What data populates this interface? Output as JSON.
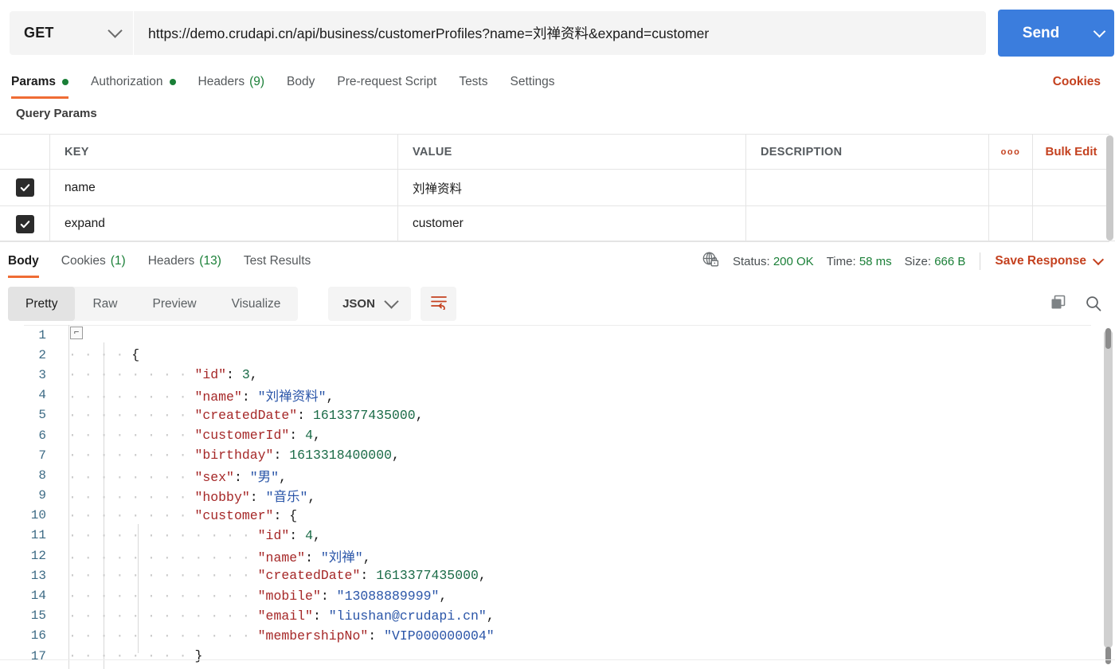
{
  "request": {
    "method": "GET",
    "url": "https://demo.crudapi.cn/api/business/customerProfiles?name=刘禅资料&expand=customer",
    "send_label": "Send",
    "tabs": [
      {
        "label": "Params",
        "badge_dot": true,
        "active": true
      },
      {
        "label": "Authorization",
        "badge_dot": true,
        "active": false
      },
      {
        "label": "Headers",
        "count": "(9)",
        "active": false
      },
      {
        "label": "Body",
        "active": false
      },
      {
        "label": "Pre-request Script",
        "active": false
      },
      {
        "label": "Tests",
        "active": false
      },
      {
        "label": "Settings",
        "active": false
      }
    ],
    "cookies_link": "Cookies"
  },
  "query_params": {
    "title": "Query Params",
    "columns": [
      "KEY",
      "VALUE",
      "DESCRIPTION"
    ],
    "dots_label": "ooo",
    "bulk_edit_label": "Bulk Edit",
    "rows": [
      {
        "checked": true,
        "key": "name",
        "value": "刘禅资料",
        "description": ""
      },
      {
        "checked": true,
        "key": "expand",
        "value": "customer",
        "description": ""
      }
    ]
  },
  "response": {
    "tabs": [
      {
        "label": "Body",
        "active": true
      },
      {
        "label": "Cookies",
        "count": "(1)",
        "active": false
      },
      {
        "label": "Headers",
        "count": "(13)",
        "active": false
      },
      {
        "label": "Test Results",
        "active": false
      }
    ],
    "status_label": "Status:",
    "status_value": "200 OK",
    "time_label": "Time:",
    "time_value": "58 ms",
    "size_label": "Size:",
    "size_value": "666 B",
    "save_response_label": "Save Response",
    "view_modes": [
      {
        "label": "Pretty",
        "active": true
      },
      {
        "label": "Raw",
        "active": false
      },
      {
        "label": "Preview",
        "active": false
      },
      {
        "label": "Visualize",
        "active": false
      }
    ],
    "format": "JSON"
  },
  "colors": {
    "accent_orange": "#ef6c34",
    "link_red": "#c4411f",
    "send_blue": "#3b7ddd",
    "success_green": "#1a7f37",
    "json_key": "#a52727",
    "json_string": "#2a55a8",
    "json_number": "#1a6b47"
  },
  "code": {
    "lines": [
      {
        "num": "1",
        "indent": 0,
        "fold": true,
        "tokens": []
      },
      {
        "num": "2",
        "indent": 1,
        "tokens": [
          {
            "t": "p",
            "v": "{"
          }
        ]
      },
      {
        "num": "3",
        "indent": 2,
        "tokens": [
          {
            "t": "k",
            "v": "\"id\""
          },
          {
            "t": "p",
            "v": ": "
          },
          {
            "t": "n",
            "v": "3"
          },
          {
            "t": "p",
            "v": ","
          }
        ]
      },
      {
        "num": "4",
        "indent": 2,
        "tokens": [
          {
            "t": "k",
            "v": "\"name\""
          },
          {
            "t": "p",
            "v": ": "
          },
          {
            "t": "s",
            "v": "\"刘禅资料\""
          },
          {
            "t": "p",
            "v": ","
          }
        ]
      },
      {
        "num": "5",
        "indent": 2,
        "tokens": [
          {
            "t": "k",
            "v": "\"createdDate\""
          },
          {
            "t": "p",
            "v": ": "
          },
          {
            "t": "n",
            "v": "1613377435000"
          },
          {
            "t": "p",
            "v": ","
          }
        ]
      },
      {
        "num": "6",
        "indent": 2,
        "tokens": [
          {
            "t": "k",
            "v": "\"customerId\""
          },
          {
            "t": "p",
            "v": ": "
          },
          {
            "t": "n",
            "v": "4"
          },
          {
            "t": "p",
            "v": ","
          }
        ]
      },
      {
        "num": "7",
        "indent": 2,
        "tokens": [
          {
            "t": "k",
            "v": "\"birthday\""
          },
          {
            "t": "p",
            "v": ": "
          },
          {
            "t": "n",
            "v": "1613318400000"
          },
          {
            "t": "p",
            "v": ","
          }
        ]
      },
      {
        "num": "8",
        "indent": 2,
        "tokens": [
          {
            "t": "k",
            "v": "\"sex\""
          },
          {
            "t": "p",
            "v": ": "
          },
          {
            "t": "s",
            "v": "\"男\""
          },
          {
            "t": "p",
            "v": ","
          }
        ]
      },
      {
        "num": "9",
        "indent": 2,
        "tokens": [
          {
            "t": "k",
            "v": "\"hobby\""
          },
          {
            "t": "p",
            "v": ": "
          },
          {
            "t": "s",
            "v": "\"音乐\""
          },
          {
            "t": "p",
            "v": ","
          }
        ]
      },
      {
        "num": "10",
        "indent": 2,
        "tokens": [
          {
            "t": "k",
            "v": "\"customer\""
          },
          {
            "t": "p",
            "v": ": {"
          }
        ]
      },
      {
        "num": "11",
        "indent": 3,
        "tokens": [
          {
            "t": "k",
            "v": "\"id\""
          },
          {
            "t": "p",
            "v": ": "
          },
          {
            "t": "n",
            "v": "4"
          },
          {
            "t": "p",
            "v": ","
          }
        ]
      },
      {
        "num": "12",
        "indent": 3,
        "tokens": [
          {
            "t": "k",
            "v": "\"name\""
          },
          {
            "t": "p",
            "v": ": "
          },
          {
            "t": "s",
            "v": "\"刘禅\""
          },
          {
            "t": "p",
            "v": ","
          }
        ]
      },
      {
        "num": "13",
        "indent": 3,
        "tokens": [
          {
            "t": "k",
            "v": "\"createdDate\""
          },
          {
            "t": "p",
            "v": ": "
          },
          {
            "t": "n",
            "v": "1613377435000"
          },
          {
            "t": "p",
            "v": ","
          }
        ]
      },
      {
        "num": "14",
        "indent": 3,
        "tokens": [
          {
            "t": "k",
            "v": "\"mobile\""
          },
          {
            "t": "p",
            "v": ": "
          },
          {
            "t": "s",
            "v": "\"13088889999\""
          },
          {
            "t": "p",
            "v": ","
          }
        ]
      },
      {
        "num": "15",
        "indent": 3,
        "tokens": [
          {
            "t": "k",
            "v": "\"email\""
          },
          {
            "t": "p",
            "v": ": "
          },
          {
            "t": "s",
            "v": "\"liushan@crudapi.cn\""
          },
          {
            "t": "p",
            "v": ","
          }
        ]
      },
      {
        "num": "16",
        "indent": 3,
        "tokens": [
          {
            "t": "k",
            "v": "\"membershipNo\""
          },
          {
            "t": "p",
            "v": ": "
          },
          {
            "t": "s",
            "v": "\"VIP000000004\""
          }
        ]
      },
      {
        "num": "17",
        "indent": 2,
        "tokens": [
          {
            "t": "p",
            "v": "}"
          }
        ]
      }
    ]
  }
}
